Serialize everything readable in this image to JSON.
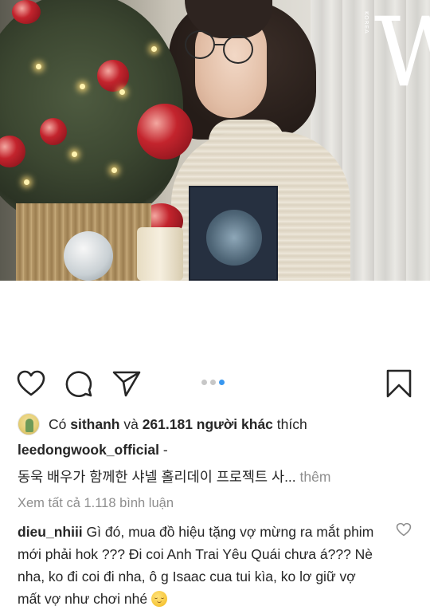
{
  "post": {
    "image": {
      "logo_letter": "W",
      "logo_sub": "KOREA"
    },
    "carousel": {
      "count": 3,
      "active_index": 2
    },
    "icons": {
      "like": "heart-outline-icon",
      "comment": "speech-bubble-icon",
      "share": "paper-plane-icon",
      "save": "bookmark-icon"
    },
    "likes": {
      "prefix": "Có ",
      "user": "sithanh",
      "middle": " và ",
      "count": "261.181 người khác",
      "suffix": " thích"
    },
    "caption": {
      "username": "leedongwook_official",
      "dash": " -",
      "text": "동욱 배우가 함께한 샤넬 홀리데이 프로젝트 사...",
      "more": " thêm"
    },
    "view_all_comments": "Xem tất cả 1.118 bình luận",
    "comment": {
      "username": "dieu_nhiii",
      "text": " Gì đó, mua đồ hiệu tặng vợ mừng ra mắt phim mới phải hok ??? Đi coi Anh Trai Yêu Quái chưa á??? Nè nha, ko đi coi đi nha, ô g Isaac cua tui kìa, ko lơ giữ vợ mất vợ như chơi nhé ",
      "emoji": "relieved-face-emoji"
    }
  },
  "colors": {
    "text": "#262626",
    "muted": "#8e8e8e",
    "carousel_active": "#3897f0",
    "carousel_inactive": "#c7c7c7"
  }
}
